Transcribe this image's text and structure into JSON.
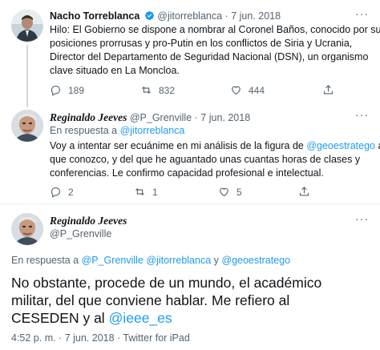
{
  "tweet1": {
    "name": "Nacho Torreblanca",
    "handle": "@jitorreblanca",
    "separator": "·",
    "date": "7 jun. 2018",
    "text_lines": [
      "Hilo: El Gobierno se dispone a nombrar al Coronel Baños, conocido por sus",
      "posiciones prorrusas y pro-Putin en los conflictos de Siria y Ucrania,",
      "Director del Departamento de Seguridad Nacional (DSN), un organismo",
      "clave situado en La Moncloa."
    ],
    "replies": "189",
    "retweets": "832",
    "likes": "444"
  },
  "tweet2": {
    "name": "Reginaldo Jeeves",
    "handle": "@P_Grenville",
    "separator": "·",
    "date": "7 jun. 2018",
    "reply_prefix": "En respuesta a",
    "reply_to": "@jitorreblanca",
    "line1_a": "Voy a intentar ser ecuánime en mi análisis de la figura de",
    "line1_mention": "@geoestratego",
    "line1_b": "al",
    "text_lines": [
      "que conozco, y del que he aguantado unas cuantas horas de clases y",
      "conferencias. Le confirmo capacidad profesional e intelectual."
    ],
    "replies": "2",
    "retweets": "1",
    "likes": "5"
  },
  "tweet3": {
    "name": "Reginaldo Jeeves",
    "handle": "@P_Grenville",
    "reply_prefix": "En respuesta a",
    "reply_to_1": "@P_Grenville",
    "reply_to_2": "@jitorreblanca",
    "reply_and": "y",
    "reply_to_3": "@geoestratego",
    "big_lines": [
      "No obstante, procede de un mundo, el académico",
      "militar, del que conviene hablar. Me refiero al"
    ],
    "big_line3_a": "CESEDEN y al",
    "big_line3_mention": "@ieee_es",
    "timestamp": "4:52 p. m. · 7 jun. 2018 · Twitter for iPad"
  },
  "colors": {
    "accent": "#1d9bf0",
    "text": "#0f1419",
    "secondary": "#536471"
  }
}
